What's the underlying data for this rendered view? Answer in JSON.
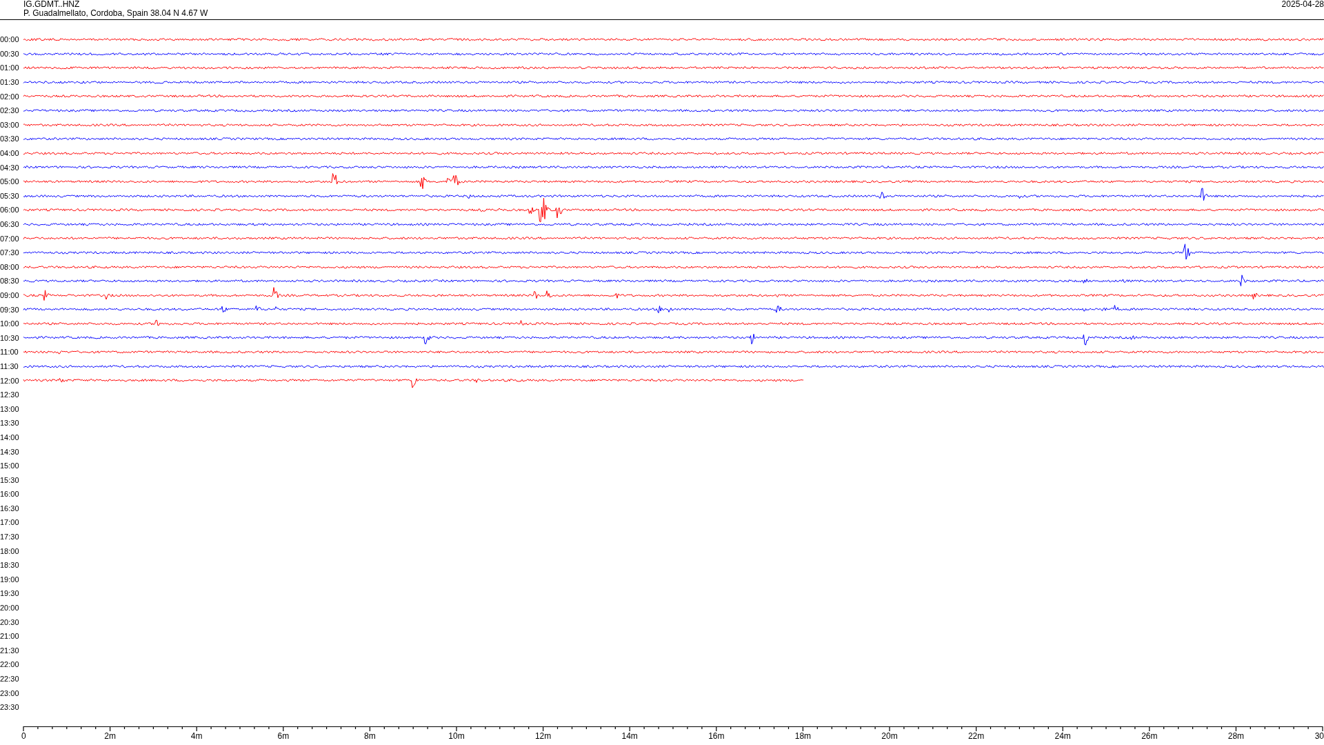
{
  "header": {
    "station": "IG.GDMT..HNZ",
    "location": "P. Guadalmellato, Cordoba, Spain  38.04 N 4.67 W",
    "date": "2025-04-28"
  },
  "rows": [
    {
      "time": "00:00",
      "color": "#ff0000",
      "level": 1
    },
    {
      "time": "00:30",
      "color": "#0000ff",
      "level": 1
    },
    {
      "time": "01:00",
      "color": "#ff0000",
      "level": 1
    },
    {
      "time": "01:30",
      "color": "#0000ff",
      "level": 1
    },
    {
      "time": "02:00",
      "color": "#ff0000",
      "level": 1
    },
    {
      "time": "02:30",
      "color": "#0000ff",
      "level": 1
    },
    {
      "time": "03:00",
      "color": "#ff0000",
      "level": 1
    },
    {
      "time": "03:30",
      "color": "#0000ff",
      "level": 1
    },
    {
      "time": "04:00",
      "color": "#ff0000",
      "level": 1
    },
    {
      "time": "04:30",
      "color": "#0000ff",
      "level": 1
    },
    {
      "time": "05:00",
      "color": "#ff0000",
      "level": 1
    },
    {
      "time": "05:30",
      "color": "#0000ff",
      "level": 1
    },
    {
      "time": "06:00",
      "color": "#ff0000",
      "level": 1
    },
    {
      "time": "06:30",
      "color": "#0000ff",
      "level": 1
    },
    {
      "time": "07:00",
      "color": "#ff0000",
      "level": 1
    },
    {
      "time": "07:30",
      "color": "#0000ff",
      "level": 1
    },
    {
      "time": "08:00",
      "color": "#ff0000",
      "level": 1
    },
    {
      "time": "08:30",
      "color": "#0000ff",
      "level": 1
    },
    {
      "time": "09:00",
      "color": "#ff0000",
      "level": 1
    },
    {
      "time": "09:30",
      "color": "#0000ff",
      "level": 1
    },
    {
      "time": "10:00",
      "color": "#ff0000",
      "level": 1
    },
    {
      "time": "10:30",
      "color": "#0000ff",
      "level": 1
    },
    {
      "time": "11:00",
      "color": "#ff0000",
      "level": 1
    },
    {
      "time": "11:30",
      "color": "#0000ff",
      "level": 1
    },
    {
      "time": "12:00",
      "color": "#ff0000",
      "level": 0.6
    },
    {
      "time": "12:30"
    },
    {
      "time": "13:00"
    },
    {
      "time": "13:30"
    },
    {
      "time": "14:00"
    },
    {
      "time": "14:30"
    },
    {
      "time": "15:00"
    },
    {
      "time": "15:30"
    },
    {
      "time": "16:00"
    },
    {
      "time": "16:30"
    },
    {
      "time": "17:00"
    },
    {
      "time": "17:30"
    },
    {
      "time": "18:00"
    },
    {
      "time": "18:30"
    },
    {
      "time": "19:00"
    },
    {
      "time": "19:30"
    },
    {
      "time": "20:00"
    },
    {
      "time": "20:30"
    },
    {
      "time": "21:00"
    },
    {
      "time": "21:30"
    },
    {
      "time": "22:00"
    },
    {
      "time": "22:30"
    },
    {
      "time": "23:00"
    },
    {
      "time": "23:30"
    }
  ],
  "axis": {
    "labels": [
      "0",
      "2m",
      "4m",
      "6m",
      "8m",
      "10m",
      "12m",
      "14m",
      "16m",
      "18m",
      "20m",
      "22m",
      "24m",
      "26m",
      "28m",
      "30"
    ]
  }
}
